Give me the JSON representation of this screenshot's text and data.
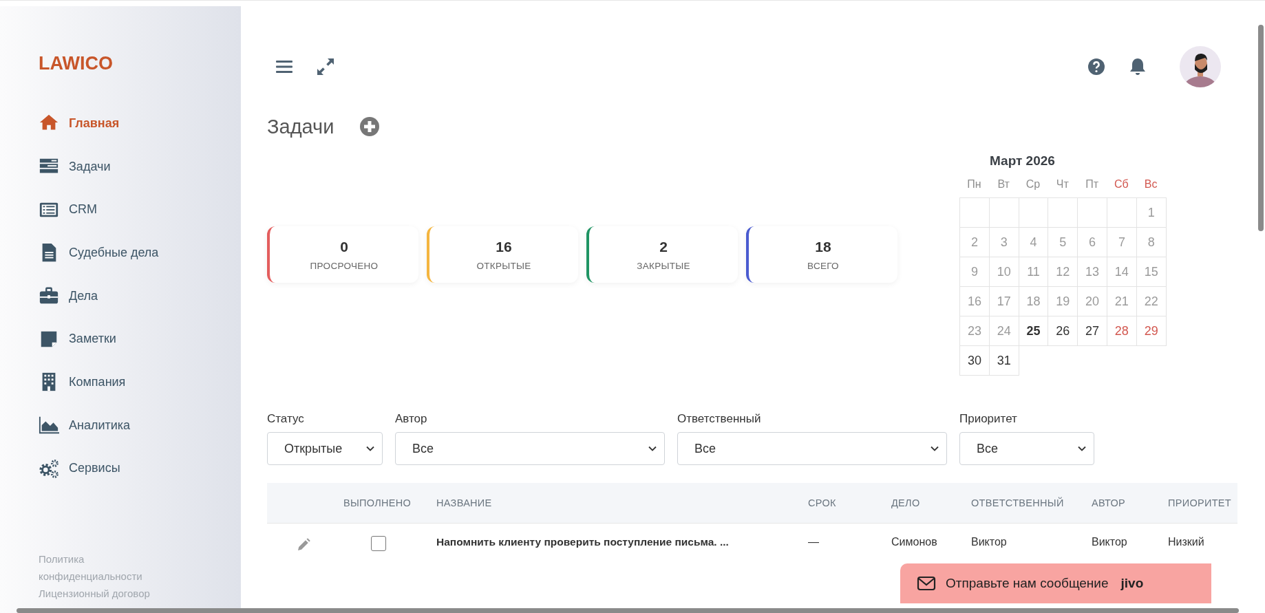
{
  "sidebar": {
    "logo": "LAWICO",
    "items": [
      {
        "label": "Главная",
        "selected": true
      },
      {
        "label": "Задачи",
        "selected": false
      },
      {
        "label": "CRM",
        "selected": false
      },
      {
        "label": "Судебные дела",
        "selected": false
      },
      {
        "label": "Дела",
        "selected": false
      },
      {
        "label": "Заметки",
        "selected": false
      },
      {
        "label": "Компания",
        "selected": false
      },
      {
        "label": "Аналитика",
        "selected": false
      },
      {
        "label": "Сервисы",
        "selected": false
      }
    ],
    "footer_links": [
      "Политика конфиденциальности",
      "Лицензионный договор"
    ]
  },
  "page_title": "Задачи",
  "stats": [
    {
      "value": "0",
      "label": "ПРОСРОЧЕНО",
      "color": "#e35d5d"
    },
    {
      "value": "16",
      "label": "ОТКРЫТЫЕ",
      "color": "#f4b53f"
    },
    {
      "value": "2",
      "label": "ЗАКРЫТЫЕ",
      "color": "#1f9463"
    },
    {
      "value": "18",
      "label": "ВСЕГО",
      "color": "#4a5bd0"
    }
  ],
  "calendar": {
    "title": "Март 2026",
    "weekdays": [
      {
        "label": "Пн",
        "weekend": false
      },
      {
        "label": "Вт",
        "weekend": false
      },
      {
        "label": "Ср",
        "weekend": false
      },
      {
        "label": "Чт",
        "weekend": false
      },
      {
        "label": "Пт",
        "weekend": false
      },
      {
        "label": "Сб",
        "weekend": true
      },
      {
        "label": "Вс",
        "weekend": true
      }
    ],
    "weeks": [
      [
        {
          "day": "1",
          "kind": "past"
        }
      ],
      [
        {
          "day": "2",
          "kind": "past"
        },
        {
          "day": "3",
          "kind": "past"
        },
        {
          "day": "4",
          "kind": "past"
        },
        {
          "day": "5",
          "kind": "past"
        },
        {
          "day": "6",
          "kind": "past"
        },
        {
          "day": "7",
          "kind": "past"
        },
        {
          "day": "8",
          "kind": "past"
        }
      ],
      [
        {
          "day": "9",
          "kind": "past"
        },
        {
          "day": "10",
          "kind": "past"
        },
        {
          "day": "11",
          "kind": "past"
        },
        {
          "day": "12",
          "kind": "past"
        },
        {
          "day": "13",
          "kind": "past"
        },
        {
          "day": "14",
          "kind": "past"
        },
        {
          "day": "15",
          "kind": "past"
        }
      ],
      [
        {
          "day": "16",
          "kind": "past"
        },
        {
          "day": "17",
          "kind": "past"
        },
        {
          "day": "18",
          "kind": "past"
        },
        {
          "day": "19",
          "kind": "past"
        },
        {
          "day": "20",
          "kind": "past"
        },
        {
          "day": "21",
          "kind": "past"
        },
        {
          "day": "22",
          "kind": "past"
        }
      ],
      [
        {
          "day": "23",
          "kind": "past"
        },
        {
          "day": "24",
          "kind": "past"
        },
        {
          "day": "25",
          "kind": "today"
        },
        {
          "day": "26",
          "kind": "future"
        },
        {
          "day": "27",
          "kind": "future"
        },
        {
          "day": "28",
          "kind": "holiday"
        },
        {
          "day": "29",
          "kind": "holiday"
        }
      ],
      [
        {
          "day": "30",
          "kind": "future"
        },
        {
          "day": "31",
          "kind": "future"
        }
      ]
    ]
  },
  "filters": [
    {
      "label": "Статус",
      "value": "Открытые",
      "kind": "narrow"
    },
    {
      "label": "Автор",
      "value": "Все",
      "kind": "wide"
    },
    {
      "label": "Ответственный",
      "value": "Все",
      "kind": "wide"
    },
    {
      "label": "Приоритет",
      "value": "Все",
      "kind": "medium"
    }
  ],
  "table": {
    "columns": [
      "ВЫПОЛНЕНО",
      "НАЗВАНИЕ",
      "СРОК",
      "ДЕЛО",
      "ОТВЕТСТВЕННЫЙ",
      "АВТОР",
      "ПРИОРИТЕТ"
    ],
    "rows": [
      {
        "done": false,
        "title": "Напомнить клиенту проверить поступление письма. ...",
        "deadline": "—",
        "case": "Симонов",
        "responsible": "Виктор",
        "author": "Виктор",
        "priority": "Низкий"
      }
    ]
  },
  "chat_widget": {
    "label": "Отправьте нам сообщение",
    "brand": "jivo"
  }
}
